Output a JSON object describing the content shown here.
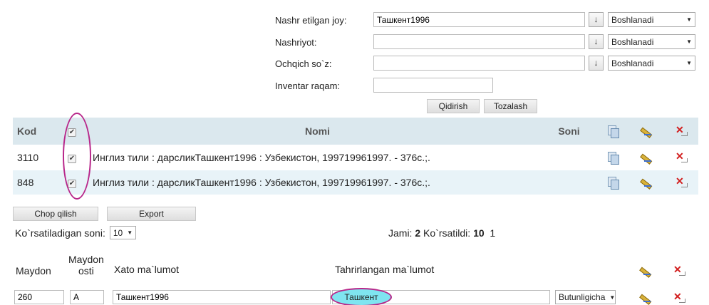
{
  "search": {
    "publish_place_label": "Nashr etilgan joy:",
    "publish_place_value": "Ташкент1996",
    "publisher_label": "Nashriyot:",
    "publisher_value": "",
    "keyword_label": "Ochqich so`z:",
    "keyword_value": "",
    "inventory_label": "Inventar raqam:",
    "inventory_value": "",
    "sort_glyph": "↓",
    "match_mode": "Boshlanadi",
    "search_button": "Qidirish",
    "clear_button": "Tozalash"
  },
  "table": {
    "headers": {
      "kod": "Kod",
      "nomi": "Nomi",
      "soni": "Soni"
    },
    "rows": [
      {
        "kod": "3110",
        "checked": true,
        "nomi": "Инглиз тили : дарсликТашкент1996 : Узбекистон, 199719961997. - 376c.;.",
        "soni": ""
      },
      {
        "kod": "848",
        "checked": true,
        "nomi": "Инглиз тили : дарсликТашкент1996 : Узбекистон, 199719961997. - 376c.;.",
        "soni": ""
      }
    ],
    "check_glyph": "✔"
  },
  "footer": {
    "print_button": "Chop qilish",
    "export_button": "Export",
    "per_page_label": "Ko`rsatiladigan soni:",
    "per_page_value": "10",
    "total_label": "Jami:",
    "total_value": "2",
    "shown_label": "Ko`rsatildi:",
    "shown_value": "10",
    "page_number": "1"
  },
  "edit": {
    "field_header": "Maydon",
    "subfield_header_line1": "Maydon",
    "subfield_header_line2": "osti",
    "error_header": "Xato ma`lumot",
    "corrected_header": "Tahrirlangan ma`lumot",
    "field_value": "260",
    "subfield_value": "A",
    "error_value": "Ташкент1996",
    "corrected_value": "Ташкент",
    "scope_value": "Butunligicha"
  },
  "icons": {
    "copy": "copy-icon",
    "edit": "edit-pencil-icon",
    "delete": "delete-icon"
  },
  "colors": {
    "header_bg": "#dbe8ee",
    "row_alt_bg": "#e8f3f8",
    "highlight_ring": "#b8268a",
    "highlight_fill": "#7fe5f0",
    "delete_red": "#d21e1e"
  }
}
